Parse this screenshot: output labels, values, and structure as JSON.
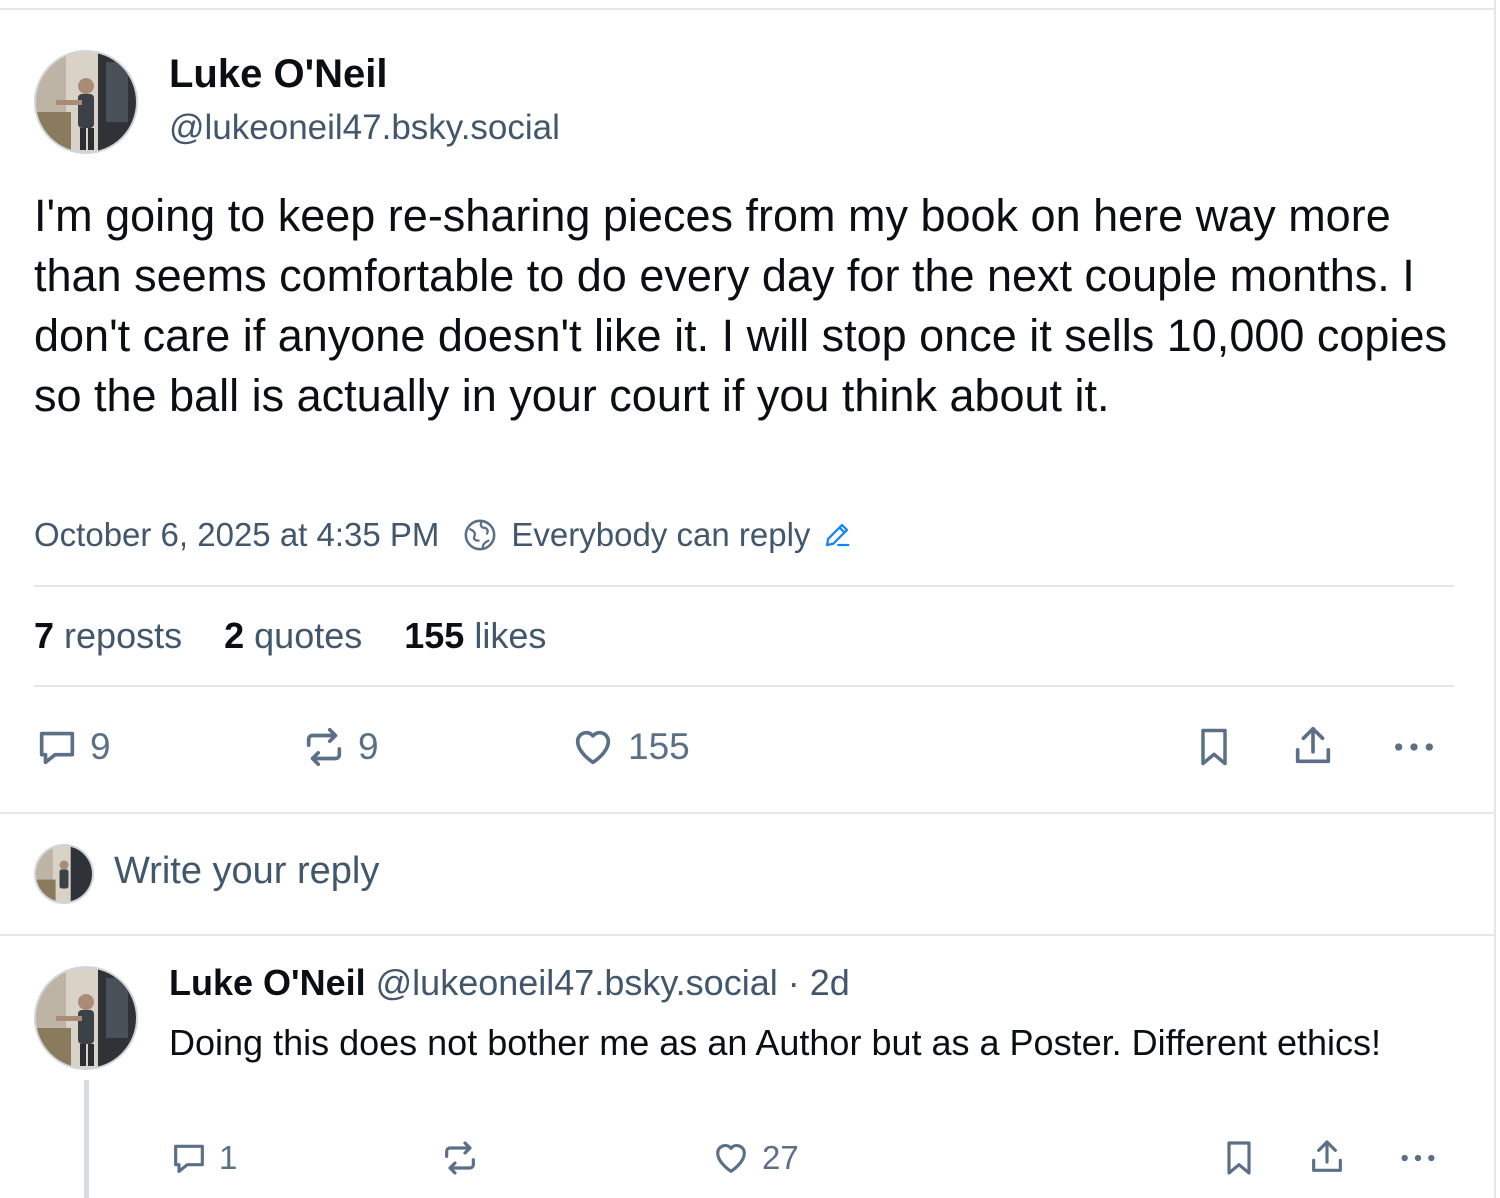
{
  "post": {
    "author_name": "Luke O'Neil",
    "author_handle": "@lukeoneil47.bsky.social",
    "text": "I'm going to keep re-sharing pieces from my book on here way more than seems comfortable to do every day for the next couple months. I don't care if anyone doesn't like it. I will stop once it sells 10,000 copies so the ball is actually in your court if you think about it.",
    "timestamp": "October 6, 2025 at 4:35 PM",
    "reply_setting": "Everybody can reply",
    "stats": {
      "reposts_count": "7",
      "reposts_label": "reposts",
      "quotes_count": "2",
      "quotes_label": "quotes",
      "likes_count": "155",
      "likes_label": "likes"
    },
    "actions": {
      "reply_count": "9",
      "repost_count": "9",
      "like_count": "155"
    }
  },
  "reply_composer": {
    "placeholder": "Write your reply"
  },
  "reply": {
    "author_name": "Luke O'Neil",
    "author_handle": "@lukeoneil47.bsky.social",
    "separator": "·",
    "age": "2d",
    "text": "Doing this does not bother me as an Author but as a Poster. Different ethics!",
    "actions": {
      "reply_count": "1",
      "repost_count": "",
      "like_count": "27"
    }
  },
  "colors": {
    "text_primary": "#0b0f14",
    "text_secondary": "#42576c",
    "icon": "#5b7087",
    "accent": "#1083fe",
    "divider": "#e3e7ec"
  },
  "icons": {
    "reply": "speech-bubble",
    "repost": "repost-arrows",
    "like": "heart",
    "bookmark": "bookmark",
    "share": "share-up-arrow",
    "more": "ellipsis",
    "reply_setting": "globe",
    "edit": "pencil"
  }
}
